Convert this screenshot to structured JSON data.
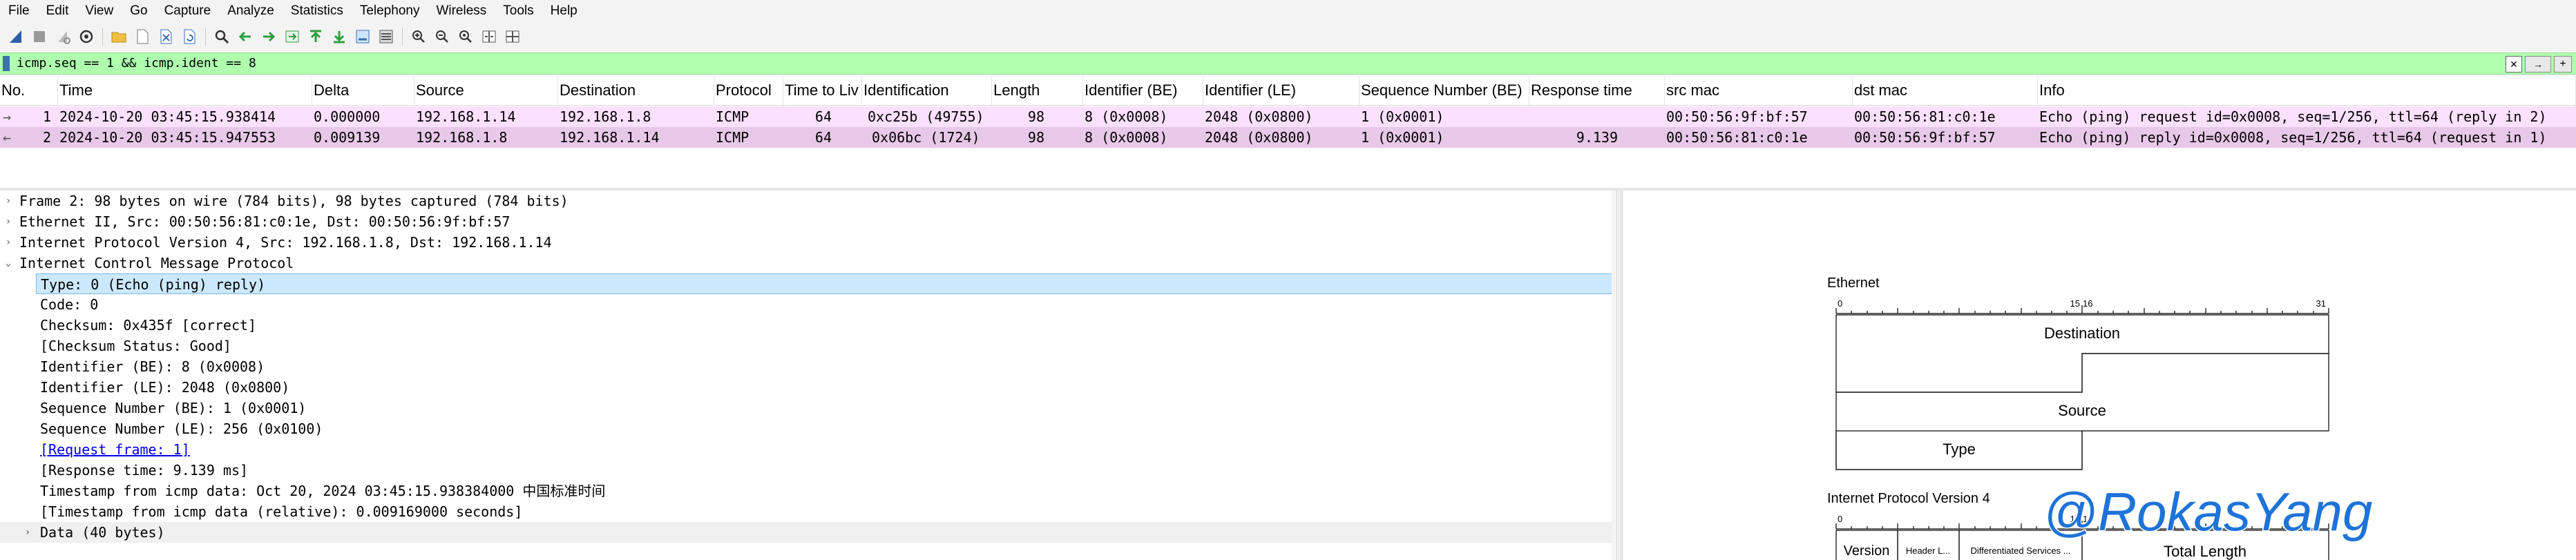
{
  "menu": [
    "File",
    "Edit",
    "View",
    "Go",
    "Capture",
    "Analyze",
    "Statistics",
    "Telephony",
    "Wireless",
    "Tools",
    "Help"
  ],
  "toolbar": {
    "icons": [
      "shark-fin-start-icon",
      "stop-icon",
      "restart-icon",
      "options-gear-icon",
      "open-folder-icon",
      "file-icon",
      "close-file-icon",
      "reload-icon",
      "search-icon",
      "back-arrow-icon",
      "forward-arrow-icon",
      "goto-packet-icon",
      "first-packet-icon",
      "last-packet-icon",
      "autoscroll-icon",
      "colorize-icon",
      "zoom-in-icon",
      "zoom-out-icon",
      "zoom-reset-icon",
      "resize-columns-icon",
      "layout-icon"
    ]
  },
  "filter": {
    "text": "icmp.seq == 1 && icmp.ident == 8",
    "clear_label": "✕",
    "apply_label": "→",
    "plus_label": "+"
  },
  "packet_list": {
    "headers": [
      "No.",
      "Time",
      "Delta",
      "Source",
      "Destination",
      "Protocol",
      "Time to Liv",
      "Identification",
      "Length",
      "Identifier (BE)",
      "Identifier (LE)",
      "Sequence Number (BE)",
      "Response time",
      "src mac",
      "dst mac",
      "Info"
    ],
    "rows": [
      {
        "no": "1",
        "arrow": "→",
        "time": "2024-10-20 03:45:15.938414",
        "delta": "0.000000",
        "source": "192.168.1.14",
        "destination": "192.168.1.8",
        "protocol": "ICMP",
        "ttl": "64",
        "identification": "0xc25b (49755)",
        "length": "98",
        "ident_be": "8 (0x0008)",
        "ident_le": "2048 (0x0800)",
        "seq_be": "1 (0x0001)",
        "response_time": "",
        "src_mac": "00:50:56:9f:bf:57",
        "dst_mac": "00:50:56:81:c0:1e",
        "info": "Echo (ping) request  id=0x0008, seq=1/256, ttl=64 (reply in 2)"
      },
      {
        "no": "2",
        "arrow": "←",
        "time": "2024-10-20 03:45:15.947553",
        "delta": "0.009139",
        "source": "192.168.1.8",
        "destination": "192.168.1.14",
        "protocol": "ICMP",
        "ttl": "64",
        "identification": "0x06bc (1724)",
        "length": "98",
        "ident_be": "8 (0x0008)",
        "ident_le": "2048 (0x0800)",
        "seq_be": "1 (0x0001)",
        "response_time": "9.139",
        "src_mac": "00:50:56:81:c0:1e",
        "dst_mac": "00:50:56:9f:bf:57",
        "info": "Echo (ping) reply    id=0x0008, seq=1/256, ttl=64 (request in 1)"
      }
    ]
  },
  "detail": {
    "lines": [
      {
        "text": "Frame 2: 98 bytes on wire (784 bits), 98 bytes captured (784 bits)",
        "arrow": "›",
        "level": 0
      },
      {
        "text": "Ethernet II, Src: 00:50:56:81:c0:1e, Dst: 00:50:56:9f:bf:57",
        "arrow": "›",
        "level": 0
      },
      {
        "text": "Internet Protocol Version 4, Src: 192.168.1.8, Dst: 192.168.1.14",
        "arrow": "›",
        "level": 0
      },
      {
        "text": "Internet Control Message Protocol",
        "arrow": "⌄",
        "level": 0
      },
      {
        "text": "Type: 0 (Echo (ping) reply)",
        "arrow": "",
        "level": 1
      },
      {
        "text": "Code: 0",
        "arrow": "",
        "level": 1
      },
      {
        "text": "Checksum: 0x435f [correct]",
        "arrow": "",
        "level": 1
      },
      {
        "text": "[Checksum Status: Good]",
        "arrow": "",
        "level": 1
      },
      {
        "text": "Identifier (BE): 8 (0x0008)",
        "arrow": "",
        "level": 1
      },
      {
        "text": "Identifier (LE): 2048 (0x0800)",
        "arrow": "",
        "level": 1
      },
      {
        "text": "Sequence Number (BE): 1 (0x0001)",
        "arrow": "",
        "level": 1
      },
      {
        "text": "Sequence Number (LE): 256 (0x0100)",
        "arrow": "",
        "level": 1
      },
      {
        "text": "[Request frame: 1]",
        "arrow": "",
        "level": 1
      },
      {
        "text": "[Response time: 9.139 ms]",
        "arrow": "",
        "level": 1
      },
      {
        "text": "Timestamp from icmp data: Oct 20, 2024 03:45:15.938384000 中国标准时间",
        "arrow": "",
        "level": 1
      },
      {
        "text": "[Timestamp from icmp data (relative): 0.009169000 seconds]",
        "arrow": "",
        "level": 1
      },
      {
        "text": "Data (40 bytes)",
        "arrow": "›",
        "level": 1
      }
    ]
  },
  "diagram": {
    "ethernet_title": "Ethernet",
    "bit_0": "0",
    "bit_15": "15",
    "bit_16": "16",
    "bit_31": "31",
    "destination_label": "Destination",
    "source_label": "Source",
    "type_label": "Type",
    "ipv4_title": "Internet Protocol Version 4",
    "version_label": "Version",
    "header_len_label": "Header L...",
    "dsf_label": "Differentiated Services ...",
    "total_length_label": "Total Length",
    "watermark": "@RokasYang"
  },
  "colors": {
    "filter_bg": "#afffaf",
    "row_request": "#fce0ff",
    "row_reply": "#e8c8e8",
    "selection": "#cce8ff",
    "watermark": "#1e73d8"
  }
}
